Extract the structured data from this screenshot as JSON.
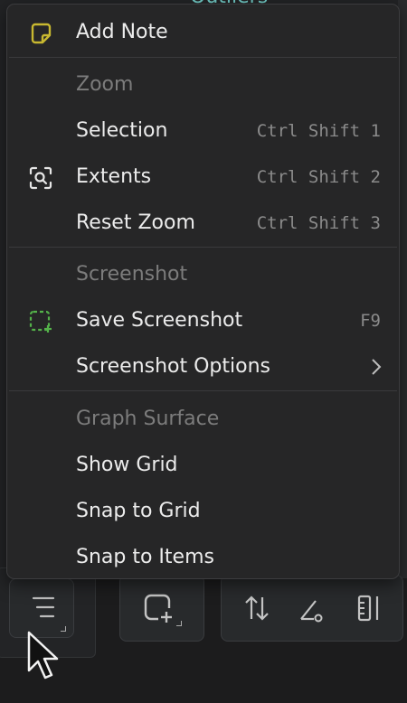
{
  "background": {
    "title_fragment": "Outliers"
  },
  "menu": {
    "add_note": "Add Note",
    "sections": {
      "zoom": {
        "header": "Zoom",
        "items": [
          {
            "label": "Selection",
            "shortcut": "Ctrl Shift 1"
          },
          {
            "label": "Extents",
            "shortcut": "Ctrl Shift 2"
          },
          {
            "label": "Reset Zoom",
            "shortcut": "Ctrl Shift 3"
          }
        ]
      },
      "screenshot": {
        "header": "Screenshot",
        "items": [
          {
            "label": "Save Screenshot",
            "shortcut": "F9"
          },
          {
            "label": "Screenshot Options"
          }
        ]
      },
      "graph_surface": {
        "header": "Graph Surface",
        "items": [
          {
            "label": "Show Grid"
          },
          {
            "label": "Snap to Grid"
          },
          {
            "label": "Snap to Items"
          }
        ]
      }
    }
  },
  "colors": {
    "note_icon": "#c8b830",
    "screenshot_icon": "#54b24a",
    "menu_bg": "#262627"
  },
  "icons": {
    "add_note": "sticky-note-icon",
    "extents": "zoom-extents-icon",
    "save_screenshot": "screenshot-add-icon",
    "submenu": "chevron-right-icon"
  }
}
